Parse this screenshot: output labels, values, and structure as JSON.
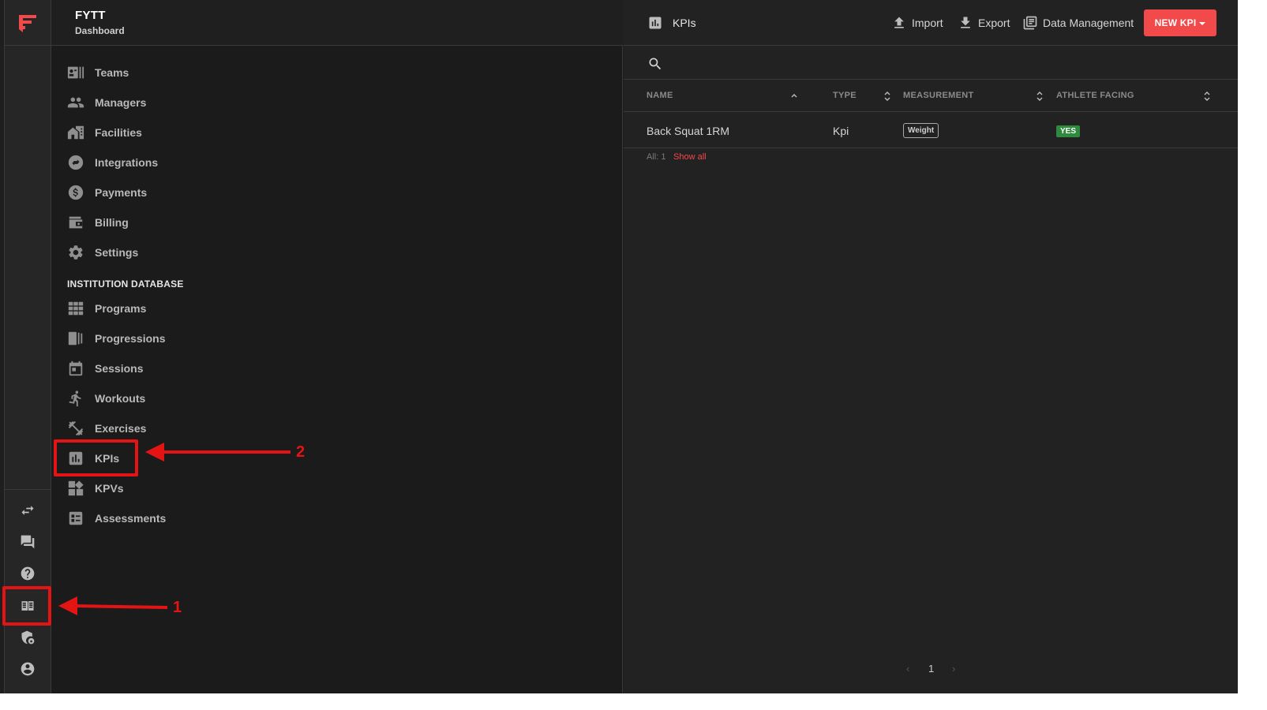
{
  "brand": {
    "title": "FYTT",
    "subtitle": "Dashboard"
  },
  "rail": {
    "items": [
      {
        "icon": "swap-arrows-icon"
      },
      {
        "icon": "chat-icon"
      },
      {
        "icon": "help-icon"
      },
      {
        "icon": "database-book-icon"
      },
      {
        "icon": "shield-lock-icon"
      },
      {
        "icon": "account-circle-icon"
      }
    ]
  },
  "nav": {
    "items": [
      {
        "label": "Teams",
        "icon": "teams-icon"
      },
      {
        "label": "Managers",
        "icon": "managers-icon"
      },
      {
        "label": "Facilities",
        "icon": "facilities-icon"
      },
      {
        "label": "Integrations",
        "icon": "integrations-icon"
      },
      {
        "label": "Payments",
        "icon": "payments-icon"
      },
      {
        "label": "Billing",
        "icon": "billing-icon"
      },
      {
        "label": "Settings",
        "icon": "settings-icon"
      }
    ],
    "section_label": "INSTITUTION DATABASE",
    "db_items": [
      {
        "label": "Programs",
        "icon": "programs-icon"
      },
      {
        "label": "Progressions",
        "icon": "progressions-icon"
      },
      {
        "label": "Sessions",
        "icon": "sessions-icon"
      },
      {
        "label": "Workouts",
        "icon": "workouts-icon"
      },
      {
        "label": "Exercises",
        "icon": "exercises-icon"
      },
      {
        "label": "KPIs",
        "icon": "kpis-icon"
      },
      {
        "label": "KPVs",
        "icon": "kpvs-icon"
      },
      {
        "label": "Assessments",
        "icon": "assessments-icon"
      }
    ]
  },
  "main": {
    "title": "KPIs",
    "toolbar": {
      "import_label": "Import",
      "export_label": "Export",
      "data_management_label": "Data Management",
      "new_label": "NEW KPI"
    },
    "search": {
      "value": "",
      "placeholder": ""
    },
    "table": {
      "columns": [
        "NAME",
        "TYPE",
        "MEASUREMENT",
        "ATHLETE FACING"
      ],
      "rows": [
        {
          "name": "Back Squat 1RM",
          "type": "Kpi",
          "measurement": "Weight",
          "athlete_facing": "YES"
        }
      ]
    },
    "footer": {
      "count": "All: 1",
      "show_all": "Show all"
    },
    "pagination": {
      "prev": "‹",
      "current": "1",
      "next": "›"
    }
  },
  "annotations": [
    {
      "number": "1"
    },
    {
      "number": "2"
    }
  ],
  "colors": {
    "accent": "#f2494b",
    "success": "#2e8b3e",
    "annotation": "#e51414"
  }
}
